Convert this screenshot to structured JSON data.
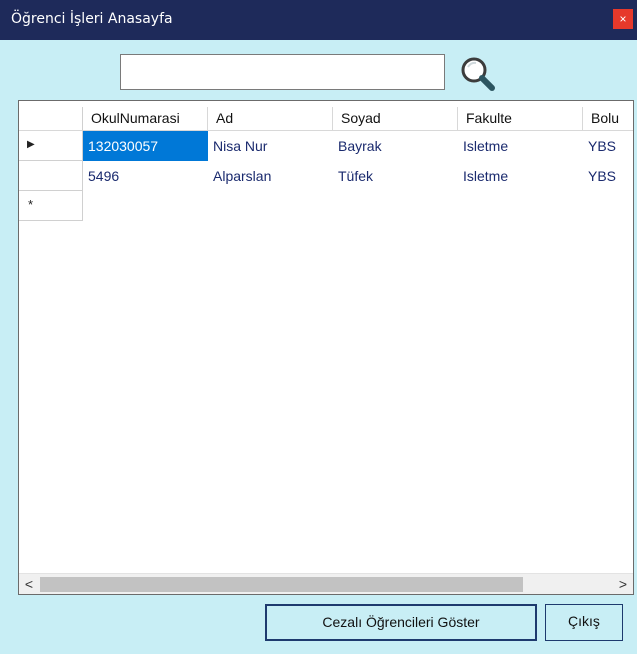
{
  "window": {
    "title": "Öğrenci İşleri Anasayfa",
    "close_glyph": "×"
  },
  "search": {
    "value": "",
    "placeholder": ""
  },
  "grid": {
    "columns": [
      "OkulNumarasi",
      "Ad",
      "Soyad",
      "Fakulte",
      "Bolu"
    ],
    "rows": [
      [
        "132030057",
        "Nisa Nur",
        "Bayrak",
        "Isletme",
        "YBS"
      ],
      [
        "5496",
        "Alparslan",
        "Tüfek",
        "Isletme",
        "YBS"
      ]
    ],
    "current_row_glyph": "▶",
    "new_row_glyph": "*",
    "scroll_left_glyph": "<",
    "scroll_right_glyph": ">"
  },
  "buttons": {
    "show_penalized": "Cezalı Öğrencileri Göster",
    "exit": "Çıkış"
  },
  "colors": {
    "title_bar": "#1e2a5a",
    "form_bg": "#c8eef5",
    "selection": "#0078d7",
    "cell_text": "#1a2a6e",
    "close_button": "#e6392b"
  },
  "icons": {
    "search": "magnifier-icon"
  }
}
